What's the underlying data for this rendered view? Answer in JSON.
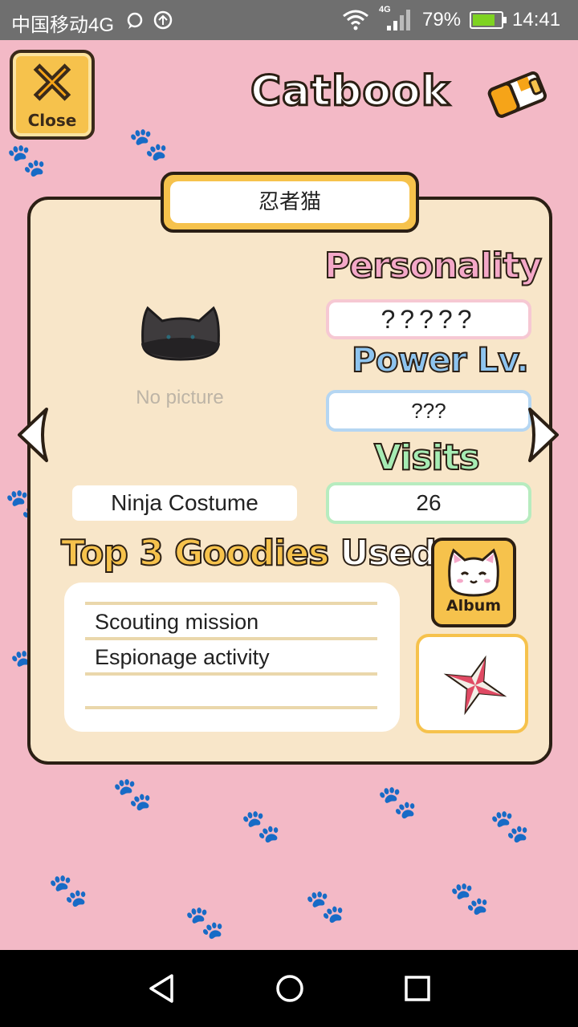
{
  "status_bar": {
    "carrier": "中国移动4G",
    "network_badge": "4G",
    "battery_percent": "79%",
    "battery_level": 0.79,
    "time": "14:41",
    "icons": [
      "message-icon",
      "sync-icon",
      "wifi-icon",
      "signal-icon",
      "battery-icon"
    ]
  },
  "header": {
    "close_label": "Close",
    "title": "Catbook"
  },
  "cat": {
    "name": "忍者猫",
    "picture_placeholder": "No picture",
    "costume": "Ninja Costume"
  },
  "stats": {
    "personality_label": "Personality",
    "personality_value": "?????",
    "power_label": "Power Lv.",
    "power_value": "???",
    "visits_label": "Visits",
    "visits_value": "26"
  },
  "goodies": {
    "title_part1": "Top 3 Goodies",
    "title_part2": "Used",
    "items": [
      "Scouting mission",
      "Espionage activity",
      ""
    ]
  },
  "album": {
    "label": "Album"
  },
  "colors": {
    "background": "#f3b9c6",
    "card": "#f8e6c9",
    "accent_yellow": "#f6c24c",
    "personality": "#f4a8c8",
    "power": "#8ec4ef",
    "visits": "#a6ecb4"
  }
}
